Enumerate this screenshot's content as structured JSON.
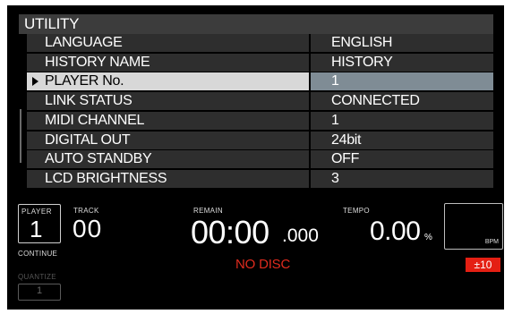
{
  "header": {
    "title": "UTILITY"
  },
  "menu": {
    "items": [
      {
        "label": "LANGUAGE",
        "value": "ENGLISH"
      },
      {
        "label": "HISTORY NAME",
        "value": "HISTORY"
      },
      {
        "label": "PLAYER No.",
        "value": "1"
      },
      {
        "label": "LINK STATUS",
        "value": "CONNECTED"
      },
      {
        "label": "MIDI CHANNEL",
        "value": "1"
      },
      {
        "label": "DIGITAL OUT",
        "value": "24bit"
      },
      {
        "label": "AUTO STANDBY",
        "value": "OFF"
      },
      {
        "label": "LCD BRIGHTNESS",
        "value": "3"
      }
    ],
    "selected_index": 2
  },
  "status": {
    "player_label": "PLAYER",
    "player_number": "1",
    "continue_label": "CONTINUE",
    "quantize_label": "QUANTIZE",
    "quantize_value": "1",
    "track_label": "TRACK",
    "track_number": "00",
    "remain_label": "REMAIN",
    "time_main": "00:00",
    "time_fraction": ".000",
    "disc_status": "NO DISC",
    "tempo_label": "TEMPO",
    "tempo_value": "0.00",
    "tempo_unit": "%",
    "bpm_label": "BPM",
    "tempo_range": "±10"
  },
  "colors": {
    "accent_red": "#e41f13",
    "selected_value_bg": "#7f8c95",
    "selected_label_bg": "#d8d8d8",
    "row_bg": "#2e2e2e",
    "title_bg": "#3c3c3c"
  }
}
